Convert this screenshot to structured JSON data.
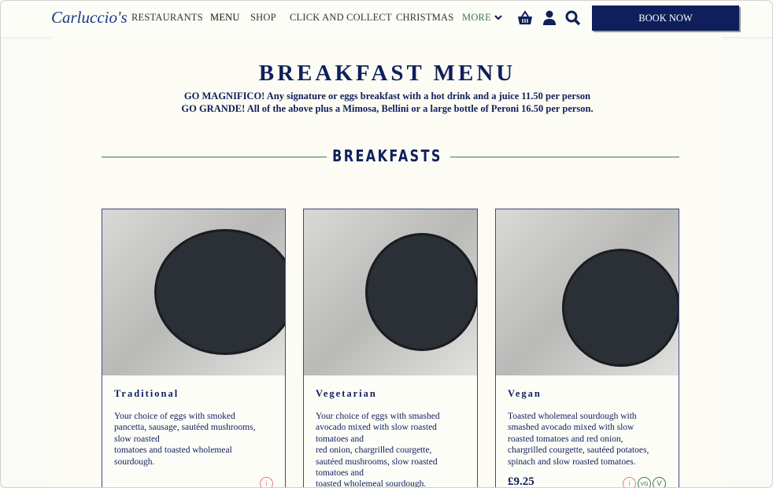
{
  "header": {
    "logo": "Carluccio's",
    "nav": [
      "RESTAURANTS",
      "MENU",
      "SHOP",
      "CLICK AND COLLECT",
      "CHRISTMAS",
      "MORE"
    ],
    "book_now": "BOOK NOW",
    "icons": [
      "basket-icon",
      "user-icon",
      "search-icon",
      "chevron-down-icon"
    ]
  },
  "page": {
    "title": "BREAKFAST MENU",
    "intro1": "GO MAGNIFICO! Any signature or eggs breakfast with a hot drink and a juice 11.50 per person",
    "intro2": "GO GRANDE! All of the above plus a Mimosa, Bellini or a large bottle of Peroni 16.50 per person.",
    "section": "BREAKFASTS"
  },
  "cards": [
    {
      "name": "Traditional",
      "desc": "Your choice of eggs with smoked\npancetta, sausage, sautéed mushrooms,\nslow roasted\ntomatoes and toasted wholemeal\nsourdough.",
      "badges": [
        "i"
      ]
    },
    {
      "name": "Vegetarian",
      "desc": "Your choice of eggs with smashed\navocado mixed with slow roasted\ntomatoes and\nred onion, chargrilled courgette,\nsautéed mushrooms, slow roasted\ntomatoes and\ntoasted wholemeal sourdough.",
      "badges": []
    },
    {
      "name": "Vegan",
      "desc": "Toasted wholemeal sourdough with\nsmashed avocado mixed with slow\nroasted tomatoes and red onion,\nchargrilled courgette, sautéed potatoes,\nspinach and slow roasted tomatoes.",
      "price": "£9.25",
      "badges": [
        "i",
        "VG",
        "V"
      ]
    }
  ],
  "colors": {
    "navy": "#0e1f5b",
    "green": "#3d7a4b",
    "allergen": "#e08080"
  }
}
